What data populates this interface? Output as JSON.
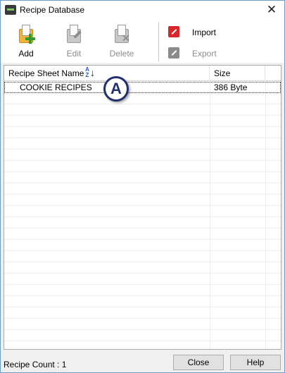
{
  "window": {
    "title": "Recipe Database",
    "close_glyph": "✕"
  },
  "toolbar": {
    "add_label": "Add",
    "edit_label": "Edit",
    "delete_label": "Delete",
    "import_label": "Import",
    "export_label": "Export"
  },
  "list": {
    "columns": [
      "Recipe Sheet Name",
      "Size"
    ],
    "sort_icon": {
      "az": "A\nZ",
      "arrow": "↓"
    },
    "rows": [
      {
        "name": "COOKIE RECIPES",
        "size": "386 Byte"
      }
    ]
  },
  "annotation": {
    "label": "A"
  },
  "footer": {
    "recipe_count": "Recipe Count : 1",
    "close_label": "Close",
    "help_label": "Help"
  },
  "colors": {
    "import_icon": "#d9262b",
    "export_icon": "#8b8b8b",
    "add_folder": "#f2b33a",
    "add_plus": "#2f9c2f",
    "badge_ring": "#23306e"
  }
}
